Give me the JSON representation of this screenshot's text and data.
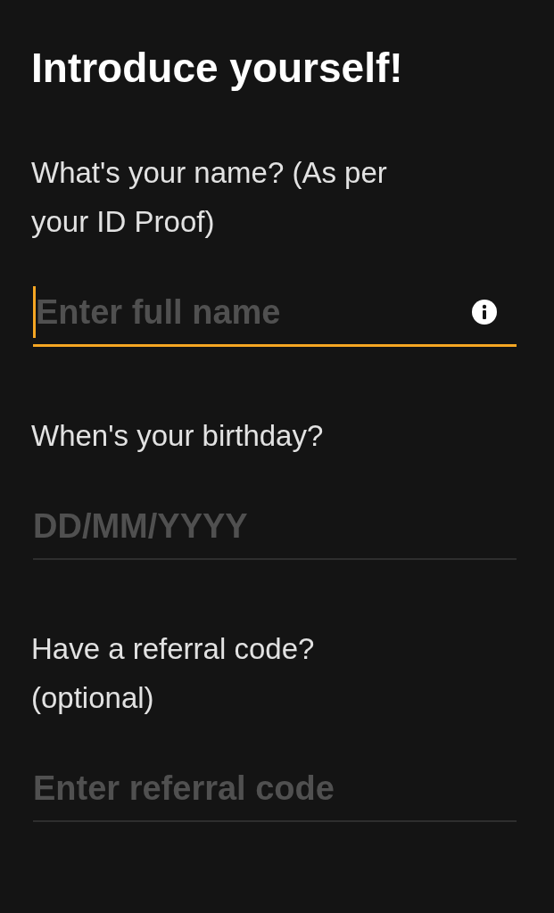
{
  "title": "Introduce yourself!",
  "fields": [
    {
      "label": "What's your name? (As per your ID Proof)",
      "placeholder": "Enter full name",
      "focused": true,
      "info_icon": true
    },
    {
      "label": "When's your birthday?",
      "placeholder": "DD/MM/YYYY",
      "focused": false,
      "info_icon": false
    },
    {
      "label": "Have a referral code? (optional)",
      "placeholder": "Enter referral code",
      "focused": false,
      "info_icon": false
    }
  ]
}
